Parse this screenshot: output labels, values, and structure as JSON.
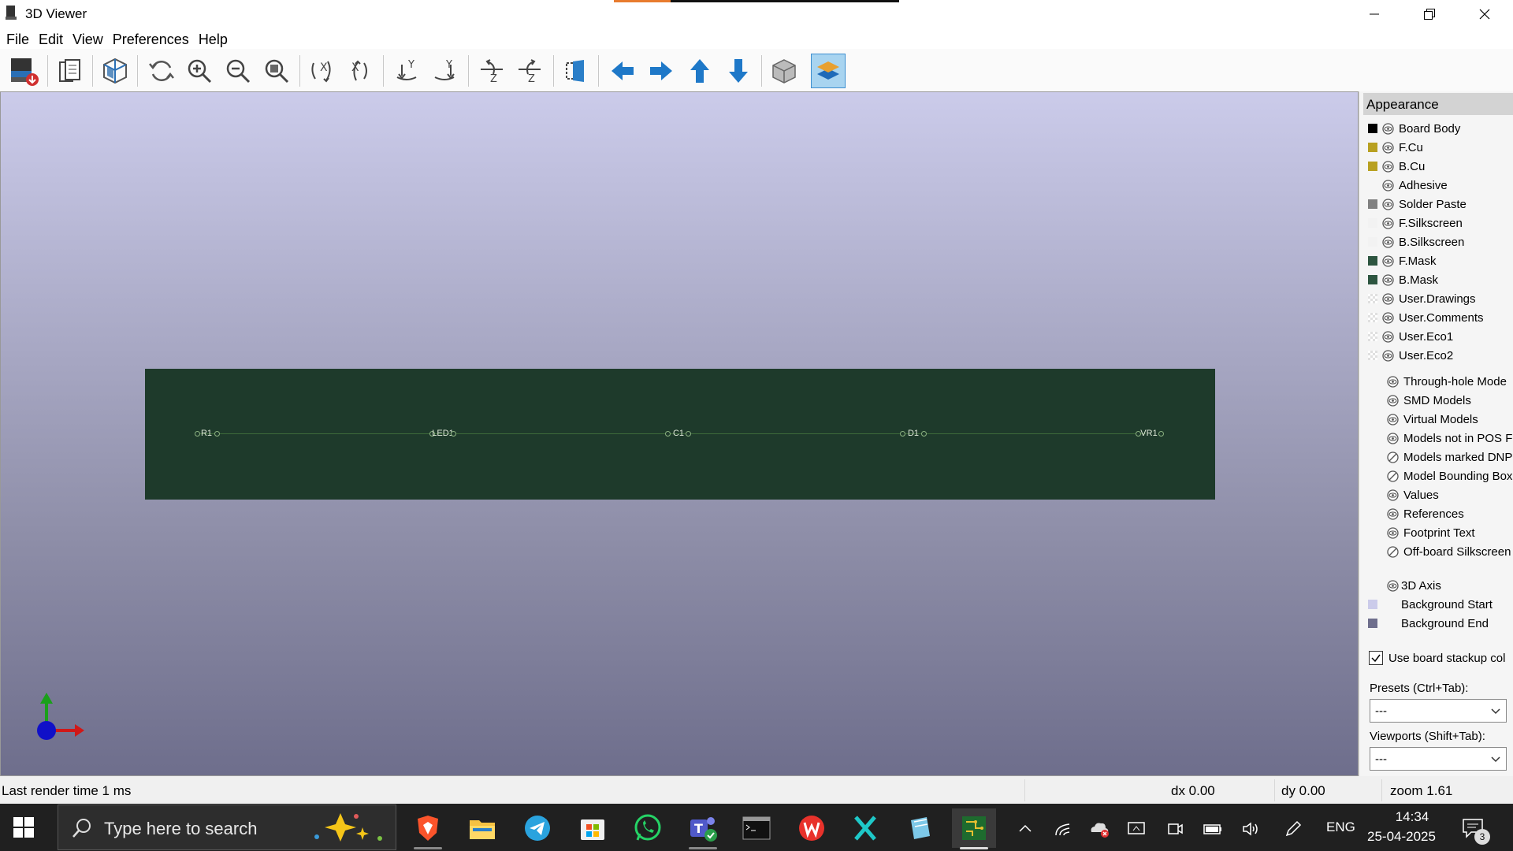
{
  "window": {
    "title": "3D Viewer",
    "controls": [
      "minimize",
      "restore",
      "close"
    ]
  },
  "menu": {
    "items": [
      {
        "label": "File"
      },
      {
        "label": "Edit"
      },
      {
        "label": "View"
      },
      {
        "label": "Preferences"
      },
      {
        "label": "Help"
      }
    ]
  },
  "toolbar": {
    "buttons": [
      {
        "icon": "export-image-icon"
      },
      {
        "icon": "copy-clipboard-icon"
      },
      {
        "icon": "raytracing-icon"
      },
      {
        "icon": "reload-icon"
      },
      {
        "icon": "zoom-in-icon"
      },
      {
        "icon": "zoom-out-icon"
      },
      {
        "icon": "zoom-fit-icon"
      },
      {
        "icon": "rotate-x-cw-icon"
      },
      {
        "icon": "rotate-x-ccw-icon"
      },
      {
        "icon": "rotate-y-cw-icon"
      },
      {
        "icon": "rotate-y-ccw-icon"
      },
      {
        "icon": "rotate-z-cw-icon"
      },
      {
        "icon": "rotate-z-ccw-icon"
      },
      {
        "icon": "flip-board-icon"
      },
      {
        "icon": "move-left-icon"
      },
      {
        "icon": "move-right-icon"
      },
      {
        "icon": "move-up-icon"
      },
      {
        "icon": "move-down-icon"
      },
      {
        "icon": "orthographic-icon"
      },
      {
        "icon": "layers-manager-icon",
        "active": true
      }
    ]
  },
  "board": {
    "color": "#1e3a2b",
    "components": [
      {
        "ref": "R1"
      },
      {
        "ref": "LED1"
      },
      {
        "ref": "C1"
      },
      {
        "ref": "D1"
      },
      {
        "ref": "VR1"
      }
    ]
  },
  "appearance": {
    "title": "Appearance",
    "layers": [
      {
        "label": "Board Body",
        "swatch": "#000000",
        "visible": true
      },
      {
        "label": "F.Cu",
        "swatch": "#b8a020",
        "visible": true
      },
      {
        "label": "B.Cu",
        "swatch": "#b8a020",
        "visible": true
      },
      {
        "label": "Adhesive",
        "swatch": null,
        "visible": true
      },
      {
        "label": "Solder Paste",
        "swatch": "#808080",
        "visible": true
      },
      {
        "label": "F.Silkscreen",
        "swatch": "#f2f2f2",
        "visible": true
      },
      {
        "label": "B.Silkscreen",
        "swatch": "#f2f2f2",
        "visible": true
      },
      {
        "label": "F.Mask",
        "swatch": "#2d5540",
        "visible": true
      },
      {
        "label": "B.Mask",
        "swatch": "#2d5540",
        "visible": true
      },
      {
        "label": "User.Drawings",
        "swatch": "checker",
        "visible": true
      },
      {
        "label": "User.Comments",
        "swatch": "checker",
        "visible": true
      },
      {
        "label": "User.Eco1",
        "swatch": "checker",
        "visible": true
      },
      {
        "label": "User.Eco2",
        "swatch": "checker",
        "visible": true
      }
    ],
    "models": [
      {
        "label": "Through-hole Mode",
        "visible": true
      },
      {
        "label": "SMD Models",
        "visible": true
      },
      {
        "label": "Virtual Models",
        "visible": true
      },
      {
        "label": "Models not in POS F",
        "visible": true
      },
      {
        "label": "Models marked DNP",
        "visible": false
      },
      {
        "label": "Model Bounding Box",
        "visible": false
      }
    ],
    "texts": [
      {
        "label": "Values",
        "visible": true
      },
      {
        "label": "References",
        "visible": true
      },
      {
        "label": "Footprint Text",
        "visible": true
      },
      {
        "label": "Off-board Silkscreen",
        "visible": false
      }
    ],
    "extras": [
      {
        "label": "3D Axis",
        "swatch": null,
        "eye": true
      },
      {
        "label": "Background Start",
        "swatch": "#cbcbea",
        "eye": false
      },
      {
        "label": "Background End",
        "swatch": "#6e6e8c",
        "eye": false
      }
    ],
    "stackup_checkbox": {
      "label": "Use board stackup col",
      "checked": true
    },
    "presets": {
      "label": "Presets (Ctrl+Tab):",
      "value": "---"
    },
    "viewports": {
      "label": "Viewports (Shift+Tab):",
      "value": "---"
    }
  },
  "status": {
    "render_time": "Last render time 1 ms",
    "dx": "dx 0.00",
    "dy": "dy 0.00",
    "zoom": "zoom 1.61"
  },
  "taskbar": {
    "search_placeholder": "Type here to search",
    "apps": [
      "brave-icon",
      "file-explorer-icon",
      "telegram-icon",
      "microsoft-store-icon",
      "whatsapp-icon",
      "teams-icon",
      "terminal-icon",
      "wps-office-icon",
      "xcode-tool-icon",
      "notepad-icon",
      "kicad-icon"
    ],
    "language": "ENG",
    "time": "14:34",
    "date": "25-04-2025",
    "notification_count": "3"
  }
}
